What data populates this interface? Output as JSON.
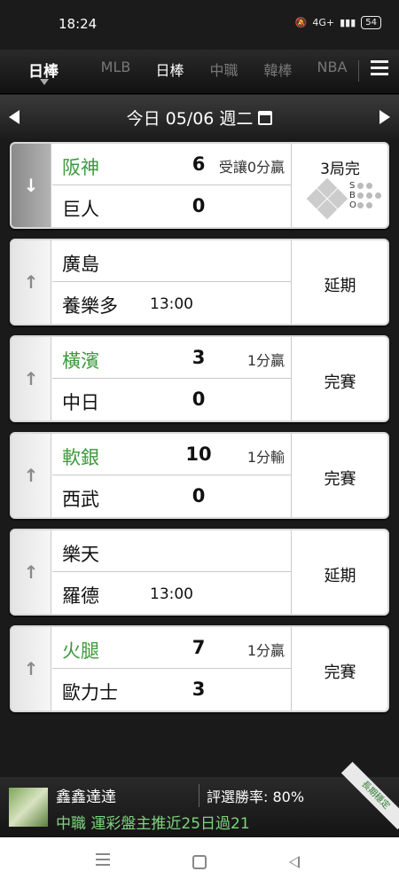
{
  "status_bar": {
    "time": "18:24",
    "network": "4G+",
    "battery": "54"
  },
  "nav": {
    "current": "日棒",
    "tabs": [
      "MLB",
      "日棒",
      "中職",
      "韓棒",
      "NBA"
    ],
    "active_tab": "日棒"
  },
  "date_bar": {
    "label": "今日 05/06 週二"
  },
  "games": [
    {
      "home": "阪神",
      "away": "巨人",
      "home_score": "6",
      "away_score": "0",
      "odds": "受讓0分贏",
      "status": "3局完",
      "time": "",
      "home_win": true,
      "selected": true
    },
    {
      "home": "廣島",
      "away": "養樂多",
      "home_score": "",
      "away_score": "",
      "odds": "",
      "status": "延期",
      "time": "13:00",
      "home_win": false,
      "selected": false
    },
    {
      "home": "橫濱",
      "away": "中日",
      "home_score": "3",
      "away_score": "0",
      "odds": "1分贏",
      "status": "完賽",
      "time": "",
      "home_win": true,
      "selected": false
    },
    {
      "home": "軟銀",
      "away": "西武",
      "home_score": "10",
      "away_score": "0",
      "odds": "1分輸",
      "status": "完賽",
      "time": "",
      "home_win": true,
      "selected": false
    },
    {
      "home": "樂天",
      "away": "羅德",
      "home_score": "",
      "away_score": "",
      "odds": "",
      "status": "延期",
      "time": "13:00",
      "home_win": false,
      "selected": false
    },
    {
      "home": "火腿",
      "away": "歐力士",
      "home_score": "7",
      "away_score": "3",
      "odds": "1分贏",
      "status": "完賽",
      "time": "",
      "home_win": true,
      "selected": false
    }
  ],
  "live_sbo": {
    "letters": [
      "S",
      "B",
      "O"
    ]
  },
  "banner": {
    "name": "鑫鑫達達",
    "rate": "評選勝率: 80%",
    "promo": "中職 運彩盤主推近25日過21",
    "ribbon": "長期穩定"
  },
  "colors": {
    "win_green": "#3c9a3c",
    "promo_green": "#7ed37e"
  }
}
